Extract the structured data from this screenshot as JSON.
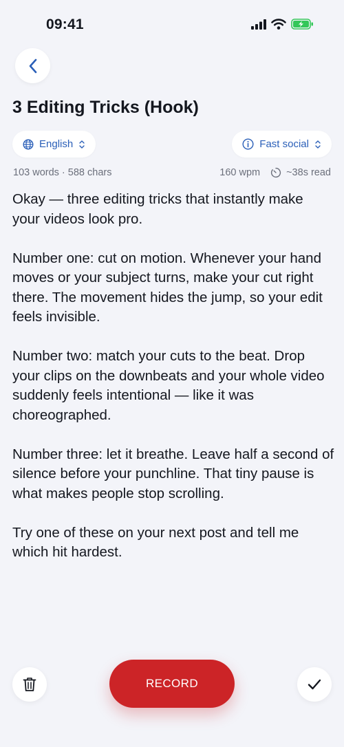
{
  "status_bar": {
    "time": "09:41",
    "icons": [
      "cellular-signal-icon",
      "wifi-icon",
      "battery-charging-icon"
    ],
    "battery_color": "#34c759"
  },
  "header": {
    "back_icon": "chevron-left-icon",
    "title": "3 Editing Tricks (Hook)"
  },
  "controls": {
    "language": {
      "icon": "globe-icon",
      "label": "English",
      "chevron": "up-down-chevron-icon"
    },
    "style": {
      "icon": "info-icon",
      "label": "Fast social",
      "chevron": "up-down-chevron-icon"
    }
  },
  "stats": {
    "counts": "103 words · 588 chars",
    "wpm": "160 wpm",
    "timer_icon": "timer-icon",
    "read_time": "~38s read"
  },
  "script": {
    "paragraphs": [
      "Okay — three editing tricks that instantly make your videos look pro.",
      "Number one: cut on motion. Whenever your hand moves or your subject turns, make your cut right there. The movement hides the jump, so your edit feels invisible.",
      "Number two: match your cuts to the beat. Drop your clips on the downbeats and your whole video suddenly feels intentional — like it was choreographed.",
      "Number three: let it breathe. Leave half a second of silence before your punchline. That tiny pause is what makes people stop scrolling.",
      "Try one of these on your next post and tell me which hit hardest."
    ]
  },
  "actions": {
    "delete_icon": "trash-icon",
    "record_label": "RECORD",
    "done_icon": "checkmark-icon"
  },
  "colors": {
    "accent": "#2a5fb8",
    "record": "#cc2427",
    "background": "#f3f4f9"
  }
}
